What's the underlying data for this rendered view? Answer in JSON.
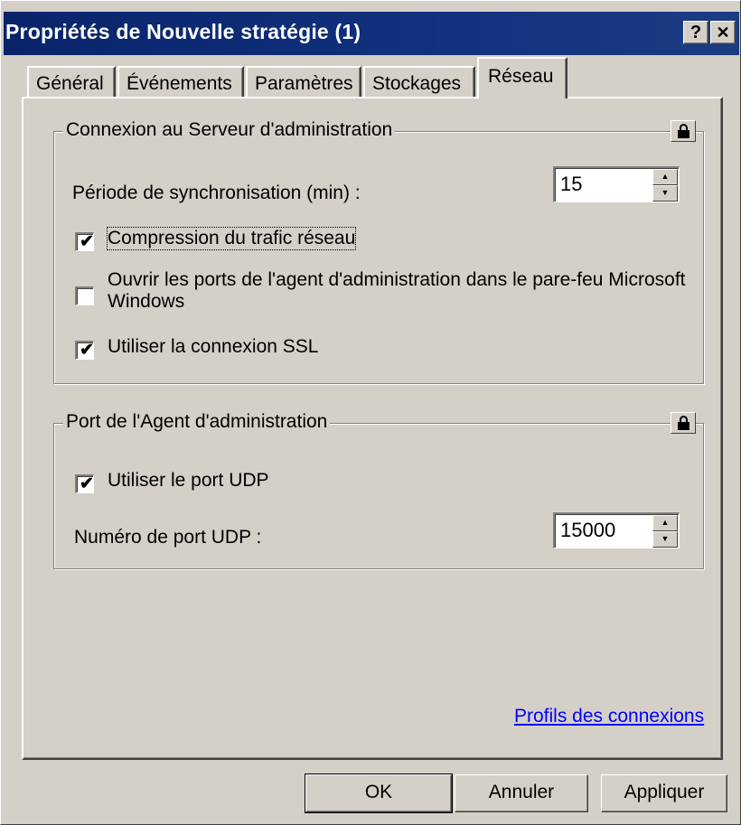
{
  "window": {
    "title": "Propriétés de Nouvelle stratégie (1)",
    "help_label": "?",
    "close_label": "✕"
  },
  "tabs": [
    {
      "label": "Général"
    },
    {
      "label": "Événements"
    },
    {
      "label": "Paramètres"
    },
    {
      "label": "Stockages"
    },
    {
      "label": "Réseau",
      "active": true
    }
  ],
  "server_group": {
    "title": "Connexion au Serveur d'administration",
    "sync_label": "Période de synchronisation (min) :",
    "sync_value": "15",
    "options": [
      {
        "label": "Compression du trafic réseau",
        "checked": true
      },
      {
        "label_line1": "Ouvrir les ports de l'agent d'administration dans le pare-feu Microsoft",
        "label_line2": "Windows",
        "checked": false
      },
      {
        "label": "Utiliser la connexion SSL",
        "checked": true
      }
    ]
  },
  "agent_group": {
    "title": "Port de l'Agent d'administration",
    "udp_checkbox_label": "Utiliser le port UDP",
    "udp_checked": true,
    "udp_port_label": "Numéro de port UDP :",
    "udp_port_value": "15000"
  },
  "link": {
    "label": "Profils des connexions"
  },
  "buttons": {
    "ok": "OK",
    "cancel": "Annuler",
    "apply": "Appliquer"
  },
  "icons": {
    "lock": "lock-icon",
    "check": "✔"
  }
}
